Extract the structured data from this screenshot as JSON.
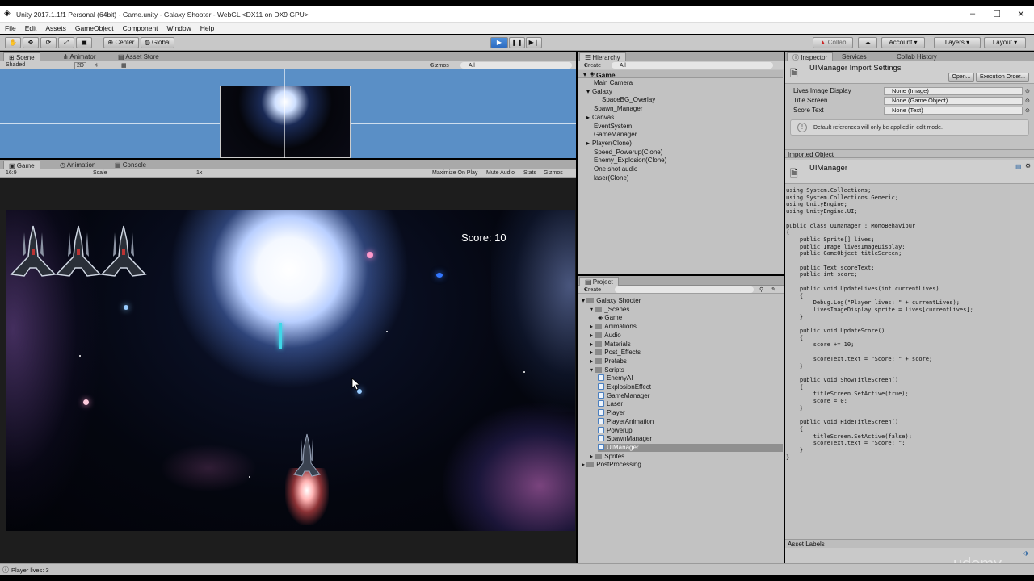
{
  "window": {
    "title": "Unity 2017.1.1f1 Personal (64bit) - Game.unity - Galaxy Shooter - WebGL <DX11 on DX9 GPU>"
  },
  "menu": [
    "File",
    "Edit",
    "Assets",
    "GameObject",
    "Component",
    "Window",
    "Help"
  ],
  "toolbar": {
    "center_label": "Center",
    "global_label": "Global",
    "collab_label": "Collab",
    "account_label": "Account",
    "layers_label": "Layers",
    "layout_label": "Layout"
  },
  "scene_panel": {
    "tabs": [
      "Scene",
      "Animator",
      "Asset Store"
    ],
    "shading": "Shaded",
    "mode_2d": "2D",
    "gizmos": "Gizmos",
    "search_placeholder": "All"
  },
  "game_panel": {
    "tabs": [
      "Game",
      "Animation",
      "Console"
    ],
    "aspect": "16:9",
    "scale_label": "Scale",
    "scale_value": "1x",
    "options": [
      "Maximize On Play",
      "Mute Audio",
      "Stats",
      "Gizmos"
    ],
    "score_text": "Score: 10",
    "lives": 3
  },
  "hierarchy": {
    "title": "Hierarchy",
    "create": "Create",
    "search_placeholder": "All",
    "scene": "Game",
    "items": [
      {
        "label": "Main Camera",
        "indent": 1
      },
      {
        "label": "Galaxy",
        "indent": 1
      },
      {
        "label": "SpaceBG_Overlay",
        "indent": 2
      },
      {
        "label": "Spawn_Manager",
        "indent": 1
      },
      {
        "label": "Canvas",
        "indent": 1
      },
      {
        "label": "EventSystem",
        "indent": 1
      },
      {
        "label": "GameManager",
        "indent": 1
      },
      {
        "label": "Player(Clone)",
        "indent": 1
      },
      {
        "label": "Speed_Powerup(Clone)",
        "indent": 1
      },
      {
        "label": "Enemy_Explosion(Clone)",
        "indent": 1
      },
      {
        "label": "One shot audio",
        "indent": 1
      },
      {
        "label": "laser(Clone)",
        "indent": 1
      }
    ]
  },
  "project": {
    "title": "Project",
    "create": "Create",
    "root": "Galaxy Shooter",
    "items": [
      {
        "label": "_Scenes",
        "type": "folder",
        "indent": 1
      },
      {
        "label": "Game",
        "type": "scene",
        "indent": 2
      },
      {
        "label": "Animations",
        "type": "folder",
        "indent": 1
      },
      {
        "label": "Audio",
        "type": "folder",
        "indent": 1
      },
      {
        "label": "Materials",
        "type": "folder",
        "indent": 1
      },
      {
        "label": "Post_Effects",
        "type": "folder",
        "indent": 1
      },
      {
        "label": "Prefabs",
        "type": "folder",
        "indent": 1
      },
      {
        "label": "Scripts",
        "type": "folder",
        "indent": 1
      },
      {
        "label": "EnemyAI",
        "type": "script",
        "indent": 2
      },
      {
        "label": "ExplosionEffect",
        "type": "script",
        "indent": 2
      },
      {
        "label": "GameManager",
        "type": "script",
        "indent": 2
      },
      {
        "label": "Laser",
        "type": "script",
        "indent": 2
      },
      {
        "label": "Player",
        "type": "script",
        "indent": 2
      },
      {
        "label": "PlayerAnimation",
        "type": "script",
        "indent": 2
      },
      {
        "label": "Powerup",
        "type": "script",
        "indent": 2
      },
      {
        "label": "SpawnManager",
        "type": "script",
        "indent": 2
      },
      {
        "label": "UIManager",
        "type": "script",
        "indent": 2,
        "selected": true
      },
      {
        "label": "Sprites",
        "type": "folder",
        "indent": 1
      },
      {
        "label": "PostProcessing",
        "type": "folder",
        "indent": 0
      }
    ]
  },
  "inspector": {
    "tabs": [
      "Inspector",
      "Services",
      "Collab History"
    ],
    "header": "UIManager Import Settings",
    "open_button": "Open...",
    "execution_order_button": "Execution Order...",
    "fields": [
      {
        "label": "Lives Image Display",
        "value": "None (Image)"
      },
      {
        "label": "Title Screen",
        "value": "None (Game Object)"
      },
      {
        "label": "Score Text",
        "value": "None (Text)"
      }
    ],
    "info": "Default references will only be applied in edit mode.",
    "imported_object_label": "Imported Object",
    "script_name": "UIManager",
    "code": "using System.Collections;\nusing System.Collections.Generic;\nusing UnityEngine;\nusing UnityEngine.UI;\n\npublic class UIManager : MonoBehaviour\n{\n    public Sprite[] lives;\n    public Image livesImageDisplay;\n    public GameObject titleScreen;\n\n    public Text scoreText;\n    public int score;\n\n    public void UpdateLives(int currentLives)\n    {\n        Debug.Log(\"Player lives: \" + currentLives);\n        livesImageDisplay.sprite = lives[currentLives];\n    }\n\n    public void UpdateScore()\n    {\n        score += 10;\n\n        scoreText.text = \"Score: \" + score;\n    }\n\n    public void ShowTitleScreen()\n    {\n        titleScreen.SetActive(true);\n        score = 0;\n    }\n\n    public void HideTitleScreen()\n    {\n        titleScreen.SetActive(false);\n        scoreText.text = \"Score: \";\n    }\n}",
    "asset_labels": "Asset Labels"
  },
  "status": {
    "message": "Player lives: 3"
  },
  "watermark": "udemy"
}
